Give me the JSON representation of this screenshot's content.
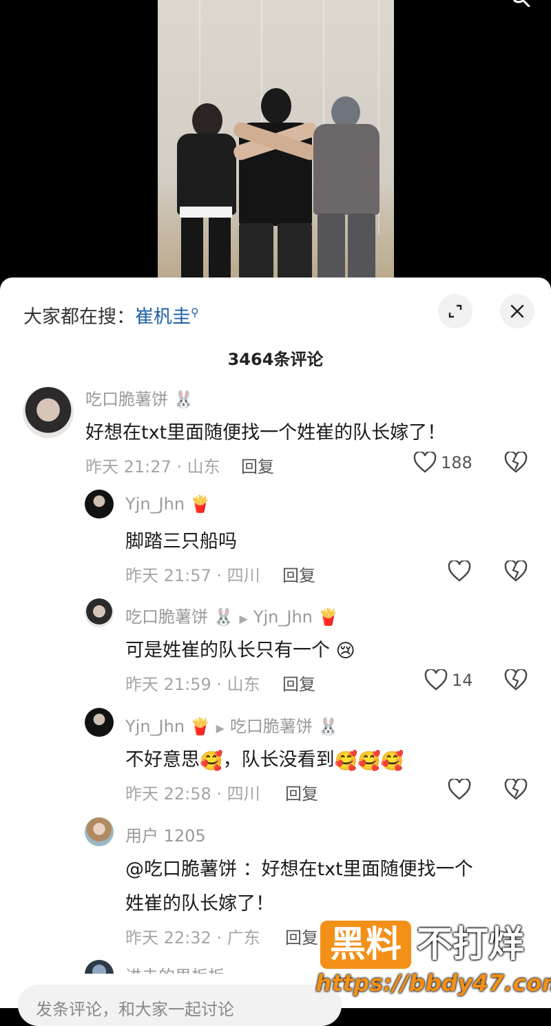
{
  "search_hint": {
    "prefix": "大家都在搜：",
    "term": "崔杋圭"
  },
  "comment_count": "3464条评论",
  "reply_label": "回复",
  "comments": [
    {
      "user": "吃口脆薯饼",
      "text": "好想在txt里面随便找一个姓崔的队长嫁了！",
      "time_loc": "昨天 21:27 · 山东",
      "likes": "188"
    },
    {
      "user": "Yjn_Jhn",
      "text": "脚踏三只船吗",
      "time_loc": "昨天 21:57 · 四川",
      "likes": ""
    },
    {
      "user": "吃口脆薯饼",
      "reply_to": "Yjn_Jhn",
      "text": "可是姓崔的队长只有一个",
      "time_loc": "昨天 21:59 · 山东",
      "likes": "14"
    },
    {
      "user": "Yjn_Jhn",
      "reply_to": "吃口脆薯饼",
      "text_a": "不好意思",
      "text_b": "，队长没看到",
      "time_loc": "昨天 22:58 · 四川",
      "likes": ""
    },
    {
      "user": "用户 1205",
      "text_line1": "@吃口脆薯饼 ：好想在txt里面随便找一个",
      "text_line2": "姓崔的队长嫁了！",
      "time_loc": "昨天 22:32 · 广东",
      "likes": ""
    },
    {
      "user": "进击的男板板"
    }
  ],
  "input_placeholder": "发条评论，和大家一起讨论",
  "watermark": {
    "badge": "黑料",
    "text": "不打烊",
    "url": "https://bbdy47.com"
  }
}
